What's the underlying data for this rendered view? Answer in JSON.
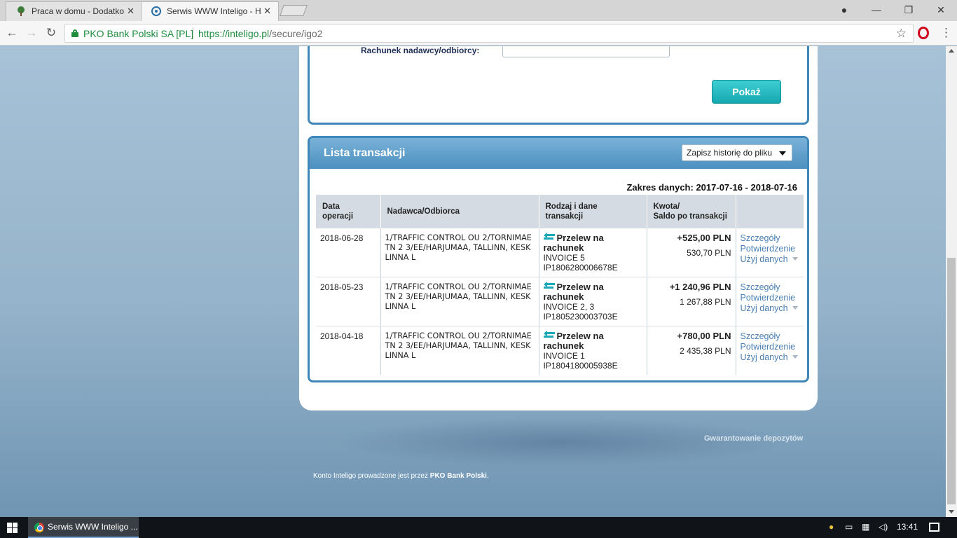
{
  "browser": {
    "tabs": [
      {
        "title": "Praca w domu - Dodatko",
        "active": false
      },
      {
        "title": "Serwis WWW Inteligo - H",
        "active": true
      }
    ],
    "secure_label": "PKO Bank Polski SA [PL]",
    "url_scheme_host": "https://inteligo.pl",
    "url_path": "/secure/igo2"
  },
  "filter": {
    "account_label": "Rachunek nadawcy/odbiorcy:",
    "show_button": "Pokaż"
  },
  "transactions": {
    "title": "Lista transakcji",
    "save_select": "Zapisz historię do pliku",
    "date_range": "Zakres danych: 2017-07-16 - 2018-07-16",
    "columns": {
      "date_l1": "Data",
      "date_l2": "operacji",
      "party": "Nadawca/Odbiorca",
      "type_l1": "Rodzaj i dane",
      "type_l2": "transakcji",
      "amount_l1": "Kwota/",
      "amount_l2": "Saldo po transakcji"
    },
    "action_labels": {
      "details": "Szczegóły",
      "confirmation": "Potwierdzenie",
      "use_data": "Użyj danych"
    },
    "rows": [
      {
        "date": "2018-06-28",
        "party": "1/TRAFFIC CONTROL OU 2/TORNIMAE TN 2 3/EE/HARJUMAA, TALLINN, KESKLINNA L",
        "type": "Przelew na rachunek",
        "desc": "INVOICE 5",
        "ref": "IP1806280006678E",
        "amount": "+525,00 PLN",
        "balance": "530,70 PLN"
      },
      {
        "date": "2018-05-23",
        "party": "1/TRAFFIC CONTROL OU 2/TORNIMAE TN 2 3/EE/HARJUMAA, TALLINN, KESKLINNA L",
        "type": "Przelew na rachunek",
        "desc": "INVOICE 2, 3",
        "ref": "IP1805230003703E",
        "amount": "+1 240,96 PLN",
        "balance": "1 267,88 PLN"
      },
      {
        "date": "2018-04-18",
        "party": "1/TRAFFIC CONTROL OU 2/TORNIMAE TN 2 3/EE/HARJUMAA, TALLINN, KESKLINNA L",
        "type": "Przelew na rachunek",
        "desc": "INVOICE 1",
        "ref": "IP1804180005938E",
        "amount": "+780,00 PLN",
        "balance": "2 435,38 PLN"
      }
    ]
  },
  "footer": {
    "deposit_link": "Gwarantowanie depozytów",
    "note_prefix": "Konto Inteligo prowadzone jest przez ",
    "note_bank": "PKO Bank Polski",
    "note_suffix": "."
  },
  "taskbar": {
    "task_label": "Serwis WWW Inteligo ...",
    "clock": "13:41"
  },
  "colors": {
    "accent_blue": "#3f86b9",
    "button_teal": "#16a8b0",
    "link": "#4a7fb3",
    "secure_green": "#1e8e3e"
  }
}
